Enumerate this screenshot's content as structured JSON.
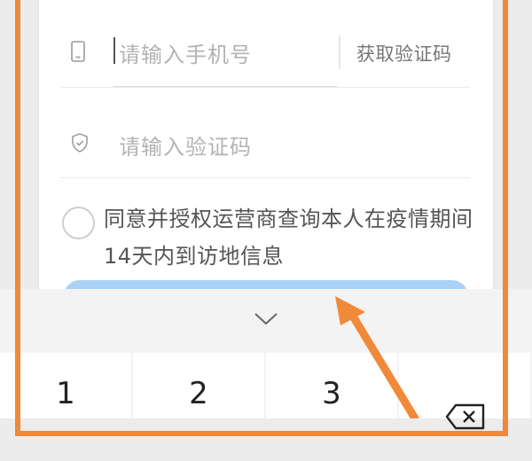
{
  "phone_field": {
    "placeholder": "请输入手机号",
    "get_code_label": "获取验证码"
  },
  "code_field": {
    "placeholder": "请输入验证码"
  },
  "agreement": {
    "text": "同意并授权运营商查询本人在疫情期间14天内到访地信息",
    "checked": false
  },
  "keyboard": {
    "keys": [
      "1",
      "2",
      "3"
    ],
    "collapse_icon": "chevron-down-icon",
    "delete_icon": "backspace-icon"
  },
  "colors": {
    "highlight": "#f0893a",
    "button": "#a9d2f4"
  }
}
